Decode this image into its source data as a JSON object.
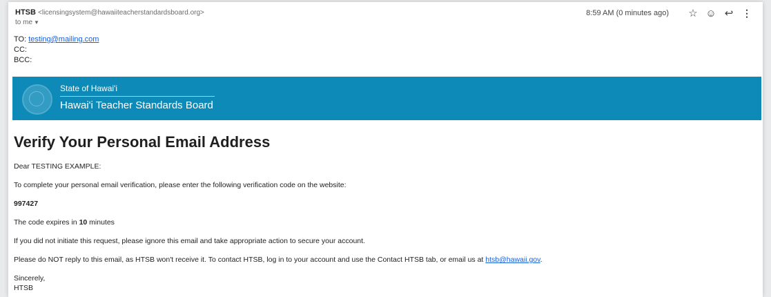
{
  "header": {
    "sender_name": "HTSB",
    "sender_email": "<licensingsystem@hawaiiteacherstandardsboard.org>",
    "to_me": "to me",
    "time": "8:59 AM (0 minutes ago)"
  },
  "icons": {
    "star": "star-icon",
    "emoji": "emoji-icon",
    "reply": "reply-icon",
    "more": "more-vert-icon"
  },
  "recipients": {
    "to_label": "TO:",
    "to_value": "testing@mailing.com",
    "cc_label": "CC:",
    "bcc_label": "BCC:"
  },
  "banner": {
    "state": "State of Hawai'i",
    "board": "Hawai'i Teacher Standards Board",
    "color": "#0d8ab8"
  },
  "body": {
    "title": "Verify Your Personal Email Address",
    "greeting": "Dear TESTING EXAMPLE:",
    "intro": "To complete your personal email verification, please enter the following verification code on the website:",
    "code": "997427",
    "expires_prefix": "The code expires in ",
    "expires_value": "10",
    "expires_suffix": " minutes",
    "ignore": "If you did not initiate this request, please ignore this email and take appropriate action to secure your account.",
    "noreply_prefix": "Please do NOT reply to this email, as HTSB won't receive it. To contact HTSB, log in to your account and use the Contact HTSB tab, or email us at ",
    "noreply_link": "htsb@hawaii.gov",
    "noreply_suffix": ".",
    "signoff": "Sincerely,",
    "signature": "HTSB"
  }
}
